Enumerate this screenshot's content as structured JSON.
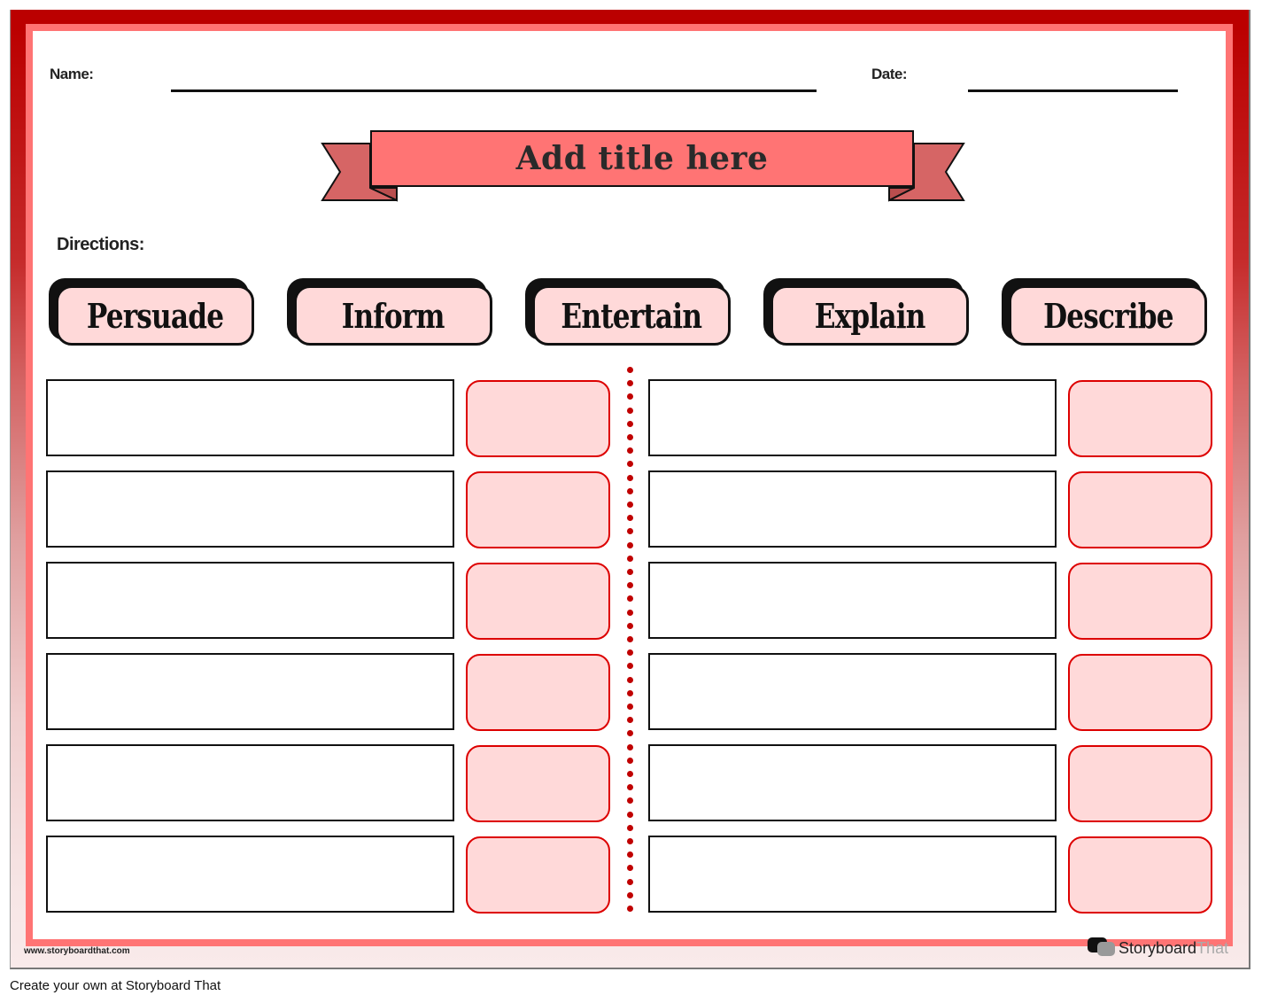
{
  "worksheet": {
    "name_label": "Name:",
    "date_label": "Date:",
    "title": "Add title here",
    "directions_label": "Directions:",
    "purposes": [
      "Persuade",
      "Inform",
      "Entertain",
      "Explain",
      "Describe"
    ],
    "rows_per_column": 6,
    "columns": 2,
    "colors": {
      "outer_border": "#bb0000",
      "inner_border": "#ff7474",
      "banner": "#ff7474",
      "banner_tails": "#d66565",
      "pill_fill": "#ffd9d9",
      "answer_box_border": "#dd0000",
      "divider_dots": "#c00000"
    }
  },
  "footer": {
    "url": "www.storyboardthat.com",
    "brand_part1": "Storyboard",
    "brand_part2": "That",
    "create_own": "Create your own at Storyboard That"
  }
}
